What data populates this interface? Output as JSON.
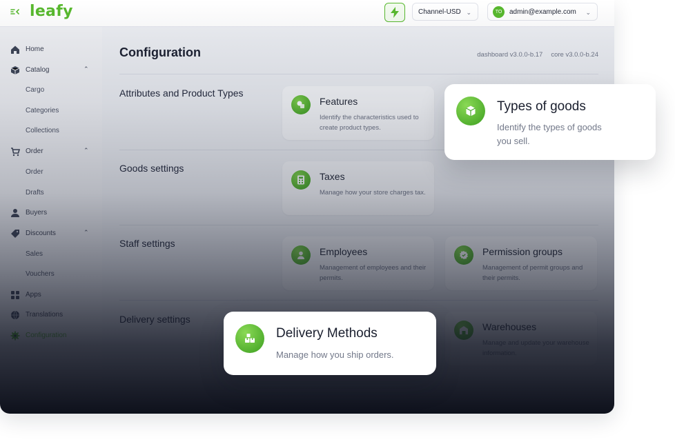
{
  "brand": {
    "logo_text": "leafy",
    "accent": "#58b92e"
  },
  "topbar": {
    "channel_select": {
      "value": "Channel-USD"
    },
    "user": {
      "initials": "TO",
      "email": "admin@example.com"
    }
  },
  "sidebar": {
    "items": [
      {
        "label": "Home",
        "icon": "home-icon"
      },
      {
        "label": "Catalog",
        "icon": "cube-icon",
        "expanded": true
      },
      {
        "label": "Cargo"
      },
      {
        "label": "Categories"
      },
      {
        "label": "Collections"
      },
      {
        "label": "Order",
        "icon": "cart-icon",
        "expanded": true
      },
      {
        "label": "Order"
      },
      {
        "label": "Drafts"
      },
      {
        "label": "Buyers",
        "icon": "user-icon"
      },
      {
        "label": "Discounts",
        "icon": "tag-icon",
        "expanded": true
      },
      {
        "label": "Sales"
      },
      {
        "label": "Vouchers"
      },
      {
        "label": "Apps",
        "icon": "grid-icon"
      },
      {
        "label": "Translations",
        "icon": "globe-icon"
      },
      {
        "label": "Configuration",
        "icon": "gear-icon",
        "active": true
      }
    ]
  },
  "main": {
    "title": "Configuration",
    "versions": {
      "dashboard": "dashboard v3.0.0-b.17",
      "core": "core v3.0.0-b.24"
    },
    "sections": [
      {
        "title": "Attributes and Product Types",
        "cards": [
          {
            "title": "Features",
            "description": "Identify the characteristics used to create product types.",
            "icon": "shapes-icon"
          }
        ]
      },
      {
        "title": "Goods settings",
        "cards": [
          {
            "title": "Taxes",
            "description": "Manage  how your store charges tax.",
            "icon": "calculator-icon"
          }
        ]
      },
      {
        "title": "Staff settings",
        "cards": [
          {
            "title": "Employees",
            "description": "Management of employees and their permits.",
            "icon": "person-icon"
          },
          {
            "title": "Permission groups",
            "description": "Management of permit groups and their permits.",
            "icon": "badge-check-icon"
          }
        ]
      },
      {
        "title": "Delivery settings",
        "cards": [
          {
            "title": "Warehouses",
            "description": "Manage and update your warehouse information.",
            "icon": "warehouse-icon"
          }
        ]
      }
    ]
  },
  "highlights": {
    "types_of_goods": {
      "title": "Types of goods",
      "description": "Identify the types of goods you sell.",
      "icon": "box-icon"
    },
    "delivery_methods": {
      "title": "Delivery Methods",
      "description": "Manage how you ship orders.",
      "icon": "packages-icon"
    }
  }
}
